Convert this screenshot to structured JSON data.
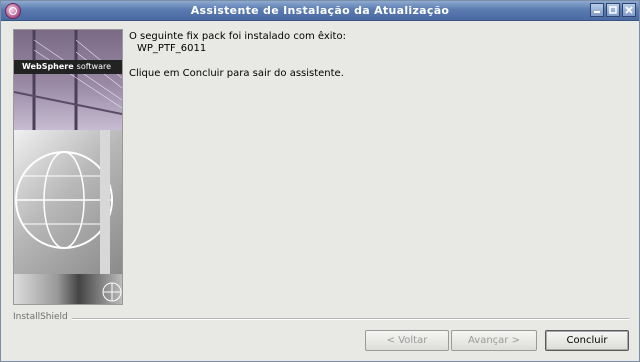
{
  "window": {
    "title": "Assistente de Instalação da Atualização",
    "controls": [
      "minimize-icon",
      "maximize-icon",
      "close-icon"
    ]
  },
  "sidebar_art": {
    "brand_main": "WebSphere",
    "brand_sub": "software"
  },
  "message": {
    "line1": "O seguinte fix pack foi instalado com êxito:",
    "fixpack": "WP_PTF_6011",
    "line3": "Clique em Concluir para sair do assistente."
  },
  "footer": {
    "installer_label": "InstallShield"
  },
  "buttons": {
    "back": "< Voltar",
    "next": "Avançar >",
    "finish": "Concluir"
  }
}
